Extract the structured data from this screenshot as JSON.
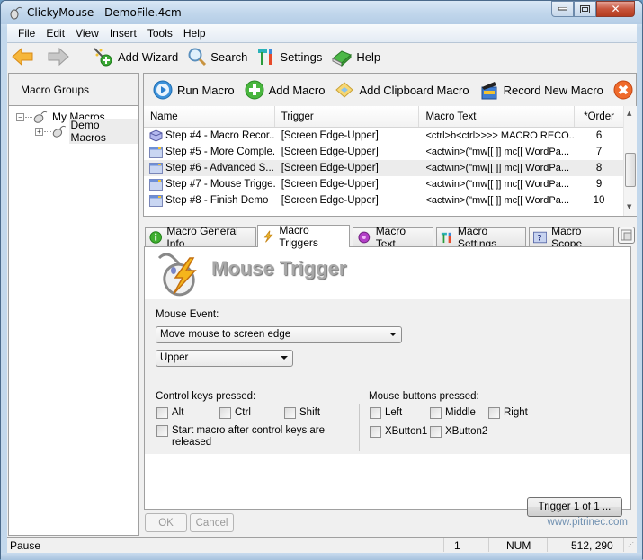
{
  "window": {
    "title": "ClickyMouse - DemoFile.4cm",
    "controls": {
      "minimize": "minimize",
      "maximize": "maximize",
      "close": "close"
    }
  },
  "menu": [
    "File",
    "Edit",
    "View",
    "Insert",
    "Tools",
    "Help"
  ],
  "toolbar": {
    "back_icon": "back-arrow-icon",
    "forward_icon": "forward-arrow-icon",
    "add_wizard": "Add Wizard",
    "search": "Search",
    "settings": "Settings",
    "help": "Help"
  },
  "sidebar": {
    "header": "Macro Groups",
    "tree": [
      {
        "label": "My Macros",
        "expander": "−"
      },
      {
        "label": "Demo Macros",
        "expander": "+",
        "selected": true
      }
    ]
  },
  "macro_toolbar": {
    "run": "Run Macro",
    "add": "Add Macro",
    "add_clipboard": "Add Clipboard Macro",
    "record": "Record New Macro",
    "delete": "Dele"
  },
  "macro_list": {
    "columns": [
      "Name",
      "Trigger",
      "Macro Text",
      "*Order"
    ],
    "rows": [
      {
        "name": "Step #4 - Macro Recor...",
        "trigger": "[Screen Edge-Upper]",
        "text": "<ctrl>b<ctrl>>>> MACRO RECO...",
        "order": "6",
        "icon": "cube-icon"
      },
      {
        "name": "Step #5 - More Comple...",
        "trigger": "[Screen Edge-Upper]",
        "text": "<actwin>(\"mw[[  ]] mc[[ WordPa...",
        "order": "7",
        "icon": "window-icon"
      },
      {
        "name": "Step #6 - Advanced S...",
        "trigger": "[Screen Edge-Upper]",
        "text": "<actwin>(\"mw[[  ]] mc[[ WordPa...",
        "order": "8",
        "icon": "window-icon",
        "highlight": true
      },
      {
        "name": "Step #7 - Mouse Trigge...",
        "trigger": "[Screen Edge-Upper]",
        "text": "<actwin>(\"mw[[  ]] mc[[ WordPa...",
        "order": "9",
        "icon": "window-icon"
      },
      {
        "name": "Step #8 - Finish Demo",
        "trigger": "[Screen Edge-Upper]",
        "text": "<actwin>(\"mw[[  ]] mc[[ WordPa...",
        "order": "10",
        "icon": "window-icon"
      }
    ]
  },
  "tabs": [
    {
      "label": "Macro General Info",
      "active": false
    },
    {
      "label": "Macro Triggers",
      "active": true
    },
    {
      "label": "Macro Text",
      "active": false
    },
    {
      "label": "Macro Settings",
      "active": false
    },
    {
      "label": "Macro Scope",
      "active": false
    }
  ],
  "trigger_panel": {
    "title": "Mouse Trigger",
    "mouse_event_label": "Mouse Event:",
    "mouse_event_value": "Move mouse to screen edge",
    "edge_value": "Upper",
    "control_keys_label": "Control keys pressed:",
    "control_keys": [
      {
        "label": "Alt",
        "checked": false
      },
      {
        "label": "Ctrl",
        "checked": false
      },
      {
        "label": "Shift",
        "checked": false
      }
    ],
    "start_after_release": {
      "label": "Start macro after control keys are released",
      "checked": false
    },
    "mouse_buttons_label": "Mouse buttons pressed:",
    "mouse_buttons": [
      {
        "label": "Left",
        "checked": false
      },
      {
        "label": "Middle",
        "checked": false
      },
      {
        "label": "Right",
        "checked": false
      },
      {
        "label": "XButton1",
        "checked": false
      },
      {
        "label": "XButton2",
        "checked": false
      }
    ],
    "trigger_button": "Trigger 1 of 1 ..."
  },
  "dialog_buttons": {
    "ok": "OK",
    "cancel": "Cancel"
  },
  "website": "www.pitrinec.com",
  "status": {
    "text": "Pause",
    "count": "1",
    "num": "NUM",
    "coords": "512, 290"
  }
}
